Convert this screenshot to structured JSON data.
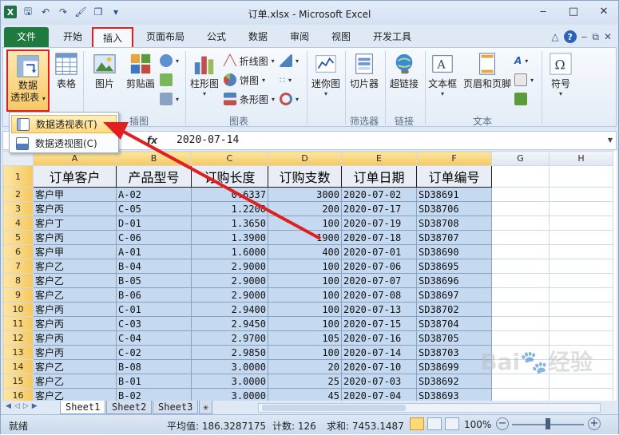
{
  "window": {
    "title": "订单.xlsx - Microsoft Excel"
  },
  "qat": {
    "app_icon": "X"
  },
  "tabs": [
    {
      "label": "文件"
    },
    {
      "label": "开始"
    },
    {
      "label": "插入"
    },
    {
      "label": "页面布局"
    },
    {
      "label": "公式"
    },
    {
      "label": "数据"
    },
    {
      "label": "审阅"
    },
    {
      "label": "视图"
    },
    {
      "label": "开发工具"
    }
  ],
  "ribbon": {
    "pivot_label_1": "数据",
    "pivot_label_2": "透视表",
    "table_label": "表格",
    "picture_label": "图片",
    "clipart_label": "剪贴画",
    "group_illustrations": "插图",
    "column_chart_label": "柱形图",
    "line_chart_label": "折线图",
    "pie_chart_label": "饼图",
    "bar_chart_label": "条形图",
    "group_charts": "图表",
    "sparkline_label": "迷你图",
    "slicer_label": "切片器",
    "group_filter": "筛选器",
    "hyperlink_label": "超链接",
    "group_links": "链接",
    "textbox_label": "文本框",
    "header_footer_label": "页眉和页脚",
    "group_text": "文本",
    "symbol_label": "符号"
  },
  "dropdown": {
    "item1": "数据透视表(T)",
    "item2": "数据透视图(C)"
  },
  "formula_bar": {
    "fx": "fx",
    "value": "2020-07-14"
  },
  "columns": [
    "A",
    "B",
    "C",
    "D",
    "E",
    "F",
    "G",
    "H"
  ],
  "table": {
    "headers": [
      "订单客户",
      "产品型号",
      "订购长度",
      "订购支数",
      "订单日期",
      "订单编号"
    ],
    "rows": [
      [
        "客户甲",
        "A-02",
        "0.6337",
        "3000",
        "2020-07-02",
        "SD38691"
      ],
      [
        "客户丙",
        "C-05",
        "1.2200",
        "200",
        "2020-07-17",
        "SD38706"
      ],
      [
        "客户丁",
        "D-01",
        "1.3650",
        "100",
        "2020-07-19",
        "SD38708"
      ],
      [
        "客户丙",
        "C-06",
        "1.3900",
        "1900",
        "2020-07-18",
        "SD38707"
      ],
      [
        "客户甲",
        "A-01",
        "1.6000",
        "400",
        "2020-07-01",
        "SD38690"
      ],
      [
        "客户乙",
        "B-04",
        "2.9000",
        "100",
        "2020-07-06",
        "SD38695"
      ],
      [
        "客户乙",
        "B-05",
        "2.9000",
        "100",
        "2020-07-07",
        "SD38696"
      ],
      [
        "客户乙",
        "B-06",
        "2.9000",
        "100",
        "2020-07-08",
        "SD38697"
      ],
      [
        "客户丙",
        "C-01",
        "2.9400",
        "100",
        "2020-07-13",
        "SD38702"
      ],
      [
        "客户丙",
        "C-03",
        "2.9450",
        "100",
        "2020-07-15",
        "SD38704"
      ],
      [
        "客户丙",
        "C-04",
        "2.9700",
        "105",
        "2020-07-16",
        "SD38705"
      ],
      [
        "客户丙",
        "C-02",
        "2.9850",
        "100",
        "2020-07-14",
        "SD38703"
      ],
      [
        "客户乙",
        "B-08",
        "3.0000",
        "20",
        "2020-07-10",
        "SD38699"
      ],
      [
        "客户乙",
        "B-01",
        "3.0000",
        "25",
        "2020-07-03",
        "SD38692"
      ],
      [
        "客户乙",
        "B-02",
        "3.0000",
        "45",
        "2020-07-04",
        "SD38693"
      ]
    ]
  },
  "sheets": [
    "Sheet1",
    "Sheet2",
    "Sheet3"
  ],
  "status": {
    "ready": "就绪",
    "average": "平均值: 186.3287175",
    "count": "计数: 126",
    "sum": "求和: 7453.1487",
    "zoom": "100%",
    "zoom_minus": "−",
    "zoom_plus": "+"
  },
  "colors": {
    "accent_red": "#e02020",
    "selection_fill": "#c5d9f1",
    "file_tab": "#1f7a3d"
  }
}
